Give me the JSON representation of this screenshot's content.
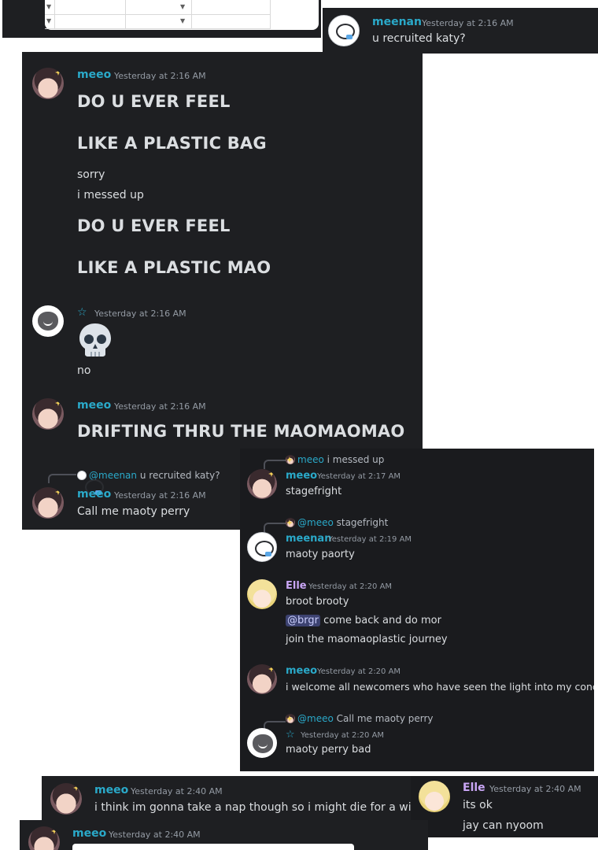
{
  "panel1": {
    "meenan": {
      "name": "meenan",
      "time": "Yesterday at 2:16 AM",
      "text": "u recruited katy?"
    }
  },
  "panel2": {
    "msg1": {
      "name": "meeo",
      "time": "Yesterday at 2:16 AM",
      "lines": [
        "DO U EVER FEEL",
        "LIKE A PLASTIC BAG",
        "sorry",
        "i messed up",
        "DO U EVER FEEL",
        "LIKE A PLASTIC MAO"
      ]
    },
    "msg2": {
      "name": "☆",
      "time": "Yesterday at 2:16 AM",
      "emoji": "skull-emoji",
      "text": "no"
    },
    "msg3": {
      "name": "meeo",
      "time": "Yesterday at 2:16 AM",
      "text": "DRIFTING THRU THE MAOMAOMAO"
    },
    "msg4": {
      "reply": {
        "name": "@meenan",
        "text": "u recruited katy?"
      },
      "name": "meeo",
      "time": "Yesterday at 2:16 AM",
      "text": "Call me maoty perry"
    }
  },
  "panel3": {
    "msg1": {
      "reply": {
        "name": "meeo",
        "text": "i messed up"
      },
      "name": "meeo",
      "time": "Yesterday at 2:17 AM",
      "text": "stagefright"
    },
    "msg2": {
      "reply": {
        "name": "@meeo",
        "text": "stagefright"
      },
      "name": "meenan",
      "time": "Yesterday at 2:19 AM",
      "text": "maoty paorty"
    },
    "msg3": {
      "name": "Elle",
      "time": "Yesterday at 2:20 AM",
      "lines": [
        "broot brooty",
        "come back and do mor",
        "join the maomaoplastic journey"
      ],
      "mention": "@brgr"
    },
    "msg4": {
      "name": "meeo",
      "time": "Yesterday at 2:20 AM",
      "text": "i welcome all newcomers who have seen the light into my concert"
    },
    "msg5": {
      "reply": {
        "name": "@meeo",
        "text": "Call me maoty perry"
      },
      "name": "☆",
      "time": "Yesterday at 2:20 AM",
      "text": "maoty perry bad"
    }
  },
  "panel4": {
    "name": "meeo",
    "time": "Yesterday at 2:40 AM",
    "text": "i think im gonna take a nap though so i might die for a wihle"
  },
  "panel5": {
    "name": "Elle",
    "time": "Yesterday at 2:40 AM",
    "lines": [
      "its ok",
      "jay can nyoom"
    ]
  },
  "panel6": {
    "name": "meeo",
    "time": "Yesterday at 2:40 AM"
  }
}
